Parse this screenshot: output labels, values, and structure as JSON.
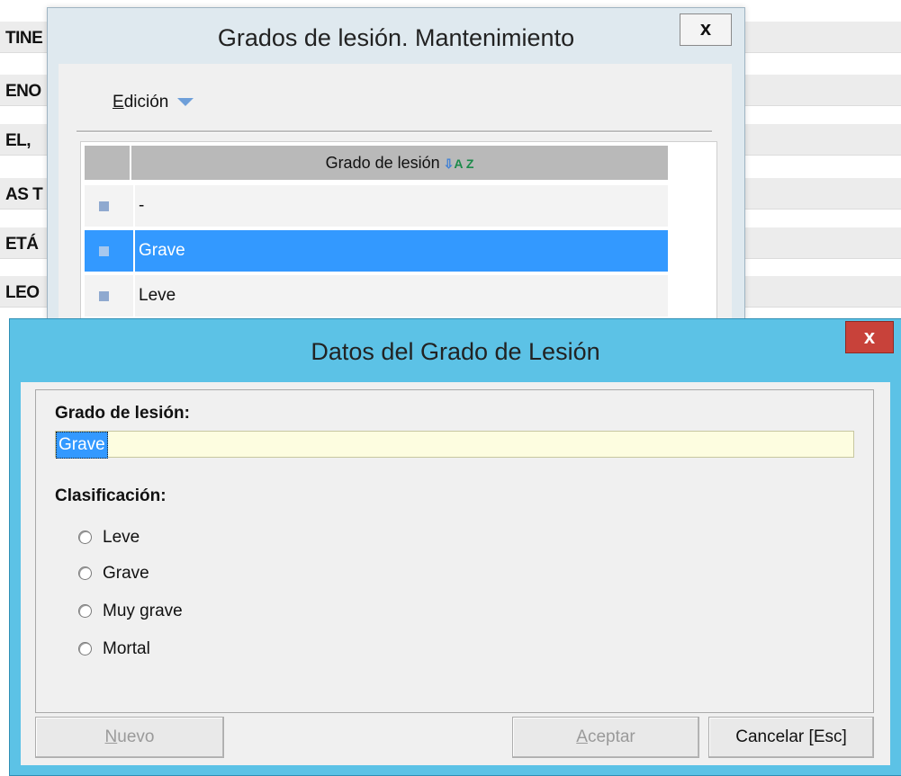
{
  "background": {
    "rows": [
      "TINE",
      "ENO",
      "EL,",
      "AS T",
      "ETÁ",
      "LEO"
    ]
  },
  "maintenance_window": {
    "title": "Grados de lesión. Mantenimiento",
    "close_label": "x",
    "menu": {
      "label_accel": "E",
      "label_rest": "dición"
    },
    "grid": {
      "column_header": "Grado de lesión",
      "sort_icon": "A Z",
      "rows": [
        {
          "value": "-",
          "selected": false
        },
        {
          "value": "Grave",
          "selected": true
        },
        {
          "value": "Leve",
          "selected": false
        }
      ]
    }
  },
  "dialog": {
    "title": "Datos del Grado de Lesión",
    "close_label": "x",
    "field_label": "Grado de lesión:",
    "field_value": "Grave",
    "classification_label": "Clasificación:",
    "options": [
      "Leve",
      "Grave",
      "Muy grave",
      "Mortal"
    ],
    "buttons": {
      "new_accel": "N",
      "new_rest": "uevo",
      "accept_accel": "A",
      "accept_rest": "ceptar",
      "cancel": "Cancelar [Esc]"
    },
    "colors": {
      "title_bar": "#5cc2e6",
      "close": "#c8423a",
      "selection": "#3399ff"
    }
  }
}
